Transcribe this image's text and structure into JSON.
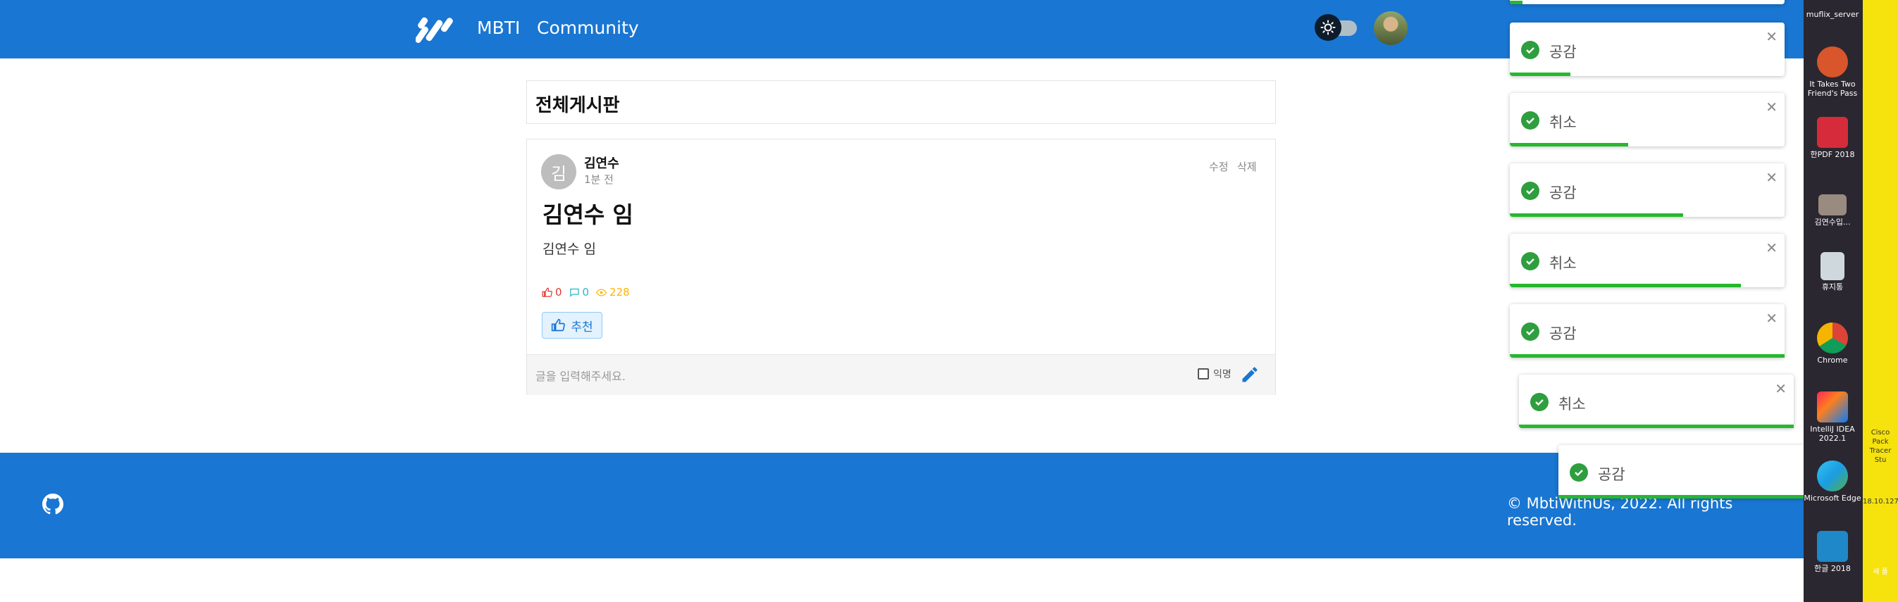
{
  "header": {
    "nav": [
      {
        "label": "MBTI"
      },
      {
        "label": "Community"
      }
    ]
  },
  "board": {
    "title": "전체게시판"
  },
  "post": {
    "avatar_letter": "김",
    "author": "김연수",
    "time": "1분 전",
    "edit_label": "수정",
    "delete_label": "삭제",
    "title": "김연수 임",
    "body": "김연수 임",
    "likes": "0",
    "comments": "0",
    "views": "228",
    "recommend_label": "추천"
  },
  "comment": {
    "placeholder": "글을 입력해주세요.",
    "anonymous_label": "익명"
  },
  "footer": {
    "copyright": "© MbtiWithUs, 2022. All rights reserved."
  },
  "toasts": [
    {
      "message": "공감",
      "progress": 0.22
    },
    {
      "message": "취소",
      "progress": 0.43
    },
    {
      "message": "공감",
      "progress": 0.63
    },
    {
      "message": "취소",
      "progress": 0.84
    },
    {
      "message": "공감",
      "progress": 1.0
    },
    {
      "message": "취소",
      "progress": 1.0
    },
    {
      "message": "공감",
      "progress": 1.0
    }
  ],
  "desktop": {
    "items": [
      {
        "label": "muflix_server"
      },
      {
        "label": "It Takes Two Friend's Pass"
      },
      {
        "label": "한PDF 2018"
      },
      {
        "label": "김연수입..."
      },
      {
        "label": "휴지통"
      },
      {
        "label": "Chrome"
      },
      {
        "label": "IntelliJ IDEA 2022.1"
      },
      {
        "label": "Microsoft Edge"
      },
      {
        "label": "한글 2018"
      }
    ],
    "partial_labels": [
      {
        "label": "Cisco Pack Tracer Stu"
      },
      {
        "label": "18.10.127"
      },
      {
        "label": "새 폴"
      }
    ]
  },
  "colors": {
    "primary": "#1976d2",
    "success": "#2e9e3e",
    "progress": "#26b82e"
  }
}
